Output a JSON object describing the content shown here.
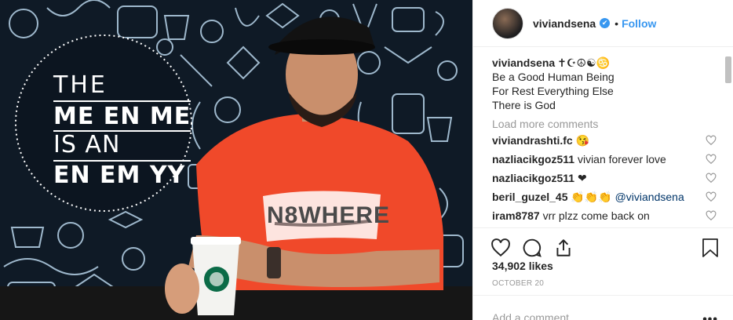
{
  "post": {
    "overlay_text": {
      "line1": "THE",
      "line2": "ME EN ME",
      "line3": "IS AN",
      "line4": "EN EM YY"
    },
    "shirt_text": "N8WHERE"
  },
  "header": {
    "username": "viviandsena",
    "verified_mark": "✔",
    "separator": "•",
    "follow_label": "Follow"
  },
  "caption": {
    "username": "viviandsena",
    "symbols": "✝☪☮☯♋",
    "lines": [
      "Be a Good Human Being",
      "For Rest Everything Else",
      "There is God"
    ]
  },
  "load_more_label": "Load more comments",
  "comments": [
    {
      "username": "viviandrashti.fc",
      "text": "😘",
      "mention": ""
    },
    {
      "username": "nazliacikgoz511",
      "text": "vivian forever love",
      "mention": ""
    },
    {
      "username": "nazliacikgoz511",
      "text": "❤",
      "mention": ""
    },
    {
      "username": "beril_guzel_45",
      "text": "👏👏👏",
      "mention": "@viviandsena"
    },
    {
      "username": "iram8787",
      "text": "vrr plzz come back on",
      "mention": ""
    }
  ],
  "likes_label": "34,902 likes",
  "date_label": "OCTOBER 20",
  "add_comment_placeholder": "Add a comment…",
  "more_options": "•••",
  "colors": {
    "link": "#3897f0",
    "shirt": "#f0492a",
    "text": "#262626",
    "muted": "#999999"
  },
  "icons": [
    "heart-icon",
    "comment-icon",
    "share-icon",
    "bookmark-icon",
    "verified-icon",
    "more-icon"
  ]
}
